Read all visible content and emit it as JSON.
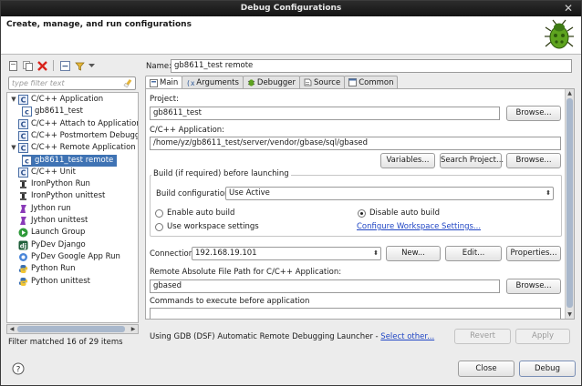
{
  "window": {
    "title": "Debug Configurations",
    "close_glyph": "✕"
  },
  "header": {
    "title": "Create, manage, and run configurations",
    "icon": "bug-icon"
  },
  "left": {
    "filter_placeholder": "type filter text",
    "tree": [
      {
        "label": "C/C++ Application",
        "level": 0,
        "expanded": true,
        "icon": "c-config-icon",
        "selected": false
      },
      {
        "label": "gb8611_test",
        "level": 1,
        "icon": "c-launch-icon",
        "selected": false
      },
      {
        "label": "C/C++ Attach to Application",
        "level": 0,
        "icon": "c-config-icon",
        "selected": false
      },
      {
        "label": "C/C++ Postmortem Debugger",
        "level": 0,
        "icon": "c-config-icon",
        "selected": false
      },
      {
        "label": "C/C++ Remote Application",
        "level": 0,
        "expanded": true,
        "icon": "c-config-icon",
        "selected": false
      },
      {
        "label": "gb8611_test remote",
        "level": 1,
        "icon": "c-launch-icon",
        "selected": true
      },
      {
        "label": "C/C++ Unit",
        "level": 0,
        "icon": "c-config-icon",
        "selected": false
      },
      {
        "label": "IronPython Run",
        "level": 0,
        "icon": "ironpython-icon",
        "selected": false
      },
      {
        "label": "IronPython unittest",
        "level": 0,
        "icon": "ironpython-icon",
        "selected": false
      },
      {
        "label": "Jython run",
        "level": 0,
        "icon": "jython-icon",
        "selected": false
      },
      {
        "label": "Jython unittest",
        "level": 0,
        "icon": "jython-icon",
        "selected": false
      },
      {
        "label": "Launch Group",
        "level": 0,
        "icon": "launch-group-icon",
        "selected": false
      },
      {
        "label": "PyDev Django",
        "level": 0,
        "icon": "django-icon",
        "selected": false
      },
      {
        "label": "PyDev Google App Run",
        "level": 0,
        "icon": "google-app-icon",
        "selected": false
      },
      {
        "label": "Python Run",
        "level": 0,
        "icon": "python-icon",
        "selected": false
      },
      {
        "label": "Python unittest",
        "level": 0,
        "icon": "python-icon",
        "selected": false
      }
    ],
    "filter_status": "Filter matched 16 of 29 items"
  },
  "main": {
    "name_label": "Name:",
    "name_value": "gb8611_test remote",
    "tabs": [
      {
        "label": "Main",
        "active": true
      },
      {
        "label": "Arguments",
        "active": false
      },
      {
        "label": "Debugger",
        "active": false
      },
      {
        "label": "Source",
        "active": false
      },
      {
        "label": "Common",
        "active": false
      }
    ],
    "project_label": "Project:",
    "project_value": "gb8611_test",
    "browse_label": "Browse...",
    "app_label": "C/C++ Application:",
    "app_value": "/home/yz/gb8611_test/server/vendor/gbase/sql/gbased",
    "variables_label": "Variables...",
    "search_project_label": "Search Project...",
    "build_group_title": "Build (if required) before launching",
    "build_config_label": "Build configuration:",
    "build_config_value": "Use Active",
    "enable_auto_build": "Enable auto build",
    "disable_auto_build": "Disable auto build",
    "use_workspace_settings": "Use workspace settings",
    "configure_workspace_link": "Configure Workspace Settings...",
    "connection_label": "Connection:",
    "connection_value": "192.168.19.101",
    "new_label": "New...",
    "edit_label": "Edit...",
    "properties_label": "Properties...",
    "remote_path_label": "Remote Absolute File Path for C/C++ Application:",
    "remote_path_value": "gbased",
    "commands_label": "Commands to execute before application",
    "launcher_text": "Using GDB (DSF) Automatic Remote Debugging Launcher - ",
    "select_other_link": "Select other...",
    "revert_label": "Revert",
    "apply_label": "Apply"
  },
  "footer": {
    "close_label": "Close",
    "debug_label": "Debug"
  }
}
